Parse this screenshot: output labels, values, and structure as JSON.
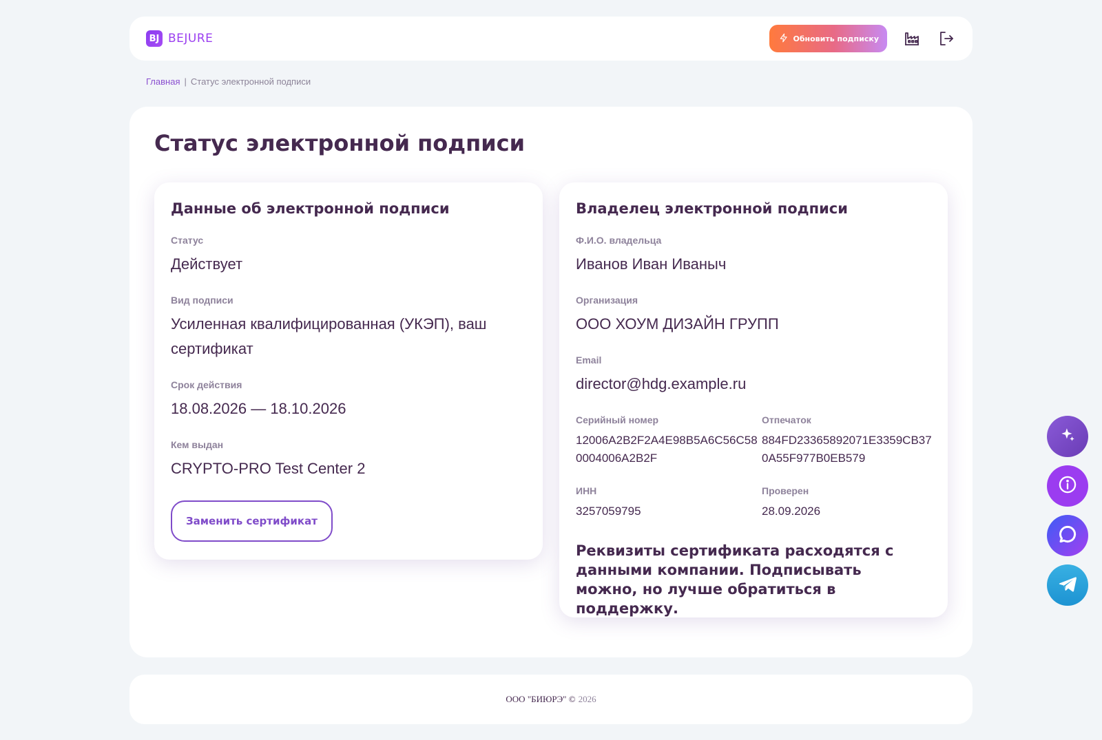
{
  "header": {
    "logo_mark": "BJ",
    "logo_text": "BEJURE",
    "upgrade_label": "Обновить подписку",
    "icons": [
      "factory-icon",
      "logout-icon"
    ]
  },
  "breadcrumb": {
    "home": "Главная",
    "separator": "|",
    "current": "Статус электронной подписи"
  },
  "page": {
    "title": "Статус электронной подписи"
  },
  "signature_card": {
    "title": "Данные об электронной подписи",
    "status_label": "Статус",
    "status_value": "Действует",
    "type_label": "Вид подписи",
    "type_value": "Усиленная квалифицированная (УКЭП), ваш сертификат",
    "validity_label": "Срок действия",
    "validity_value": "18.08.2026 — 18.10.2026",
    "issuer_label": "Кем выдан",
    "issuer_value": "CRYPTO-PRO Test Center 2",
    "replace_button": "Заменить сертификат"
  },
  "owner_card": {
    "title": "Владелец электронной подписи",
    "name_label": "Ф.И.О. владельца",
    "name_value": "Иванов Иван Иваныч",
    "org_label": "Организация",
    "org_value": "ООО ХОУМ ДИЗАЙН ГРУПП",
    "email_label": "Email",
    "email_value": "director@hdg.example.ru",
    "serial_label": "Серийный номер",
    "serial_value": "12006A2B2F2A4E98B5A6C56C580004006A2B2F",
    "thumbprint_label": "Отпечаток",
    "thumbprint_value": "884FD23365892071E3359CB370A55F977B0EB579",
    "inn_label": "ИНН",
    "inn_value": "3257059795",
    "checked_label": "Проверен",
    "checked_value": "28.09.2026",
    "warning": "Реквизиты сертификата расходятся с данными компании. Подписывать можно, но лучше обратиться в поддержку."
  },
  "footer": {
    "company": "ООО \"БИЮРЭ\" ©",
    "year": "2026"
  },
  "floating_buttons": [
    "ai-sparkle-icon",
    "info-icon",
    "chat-icon",
    "telegram-icon"
  ],
  "colors": {
    "background": "#f2f5f8",
    "text": "#45294f",
    "accent": "#7f4bc9",
    "label": "#8e829b"
  }
}
